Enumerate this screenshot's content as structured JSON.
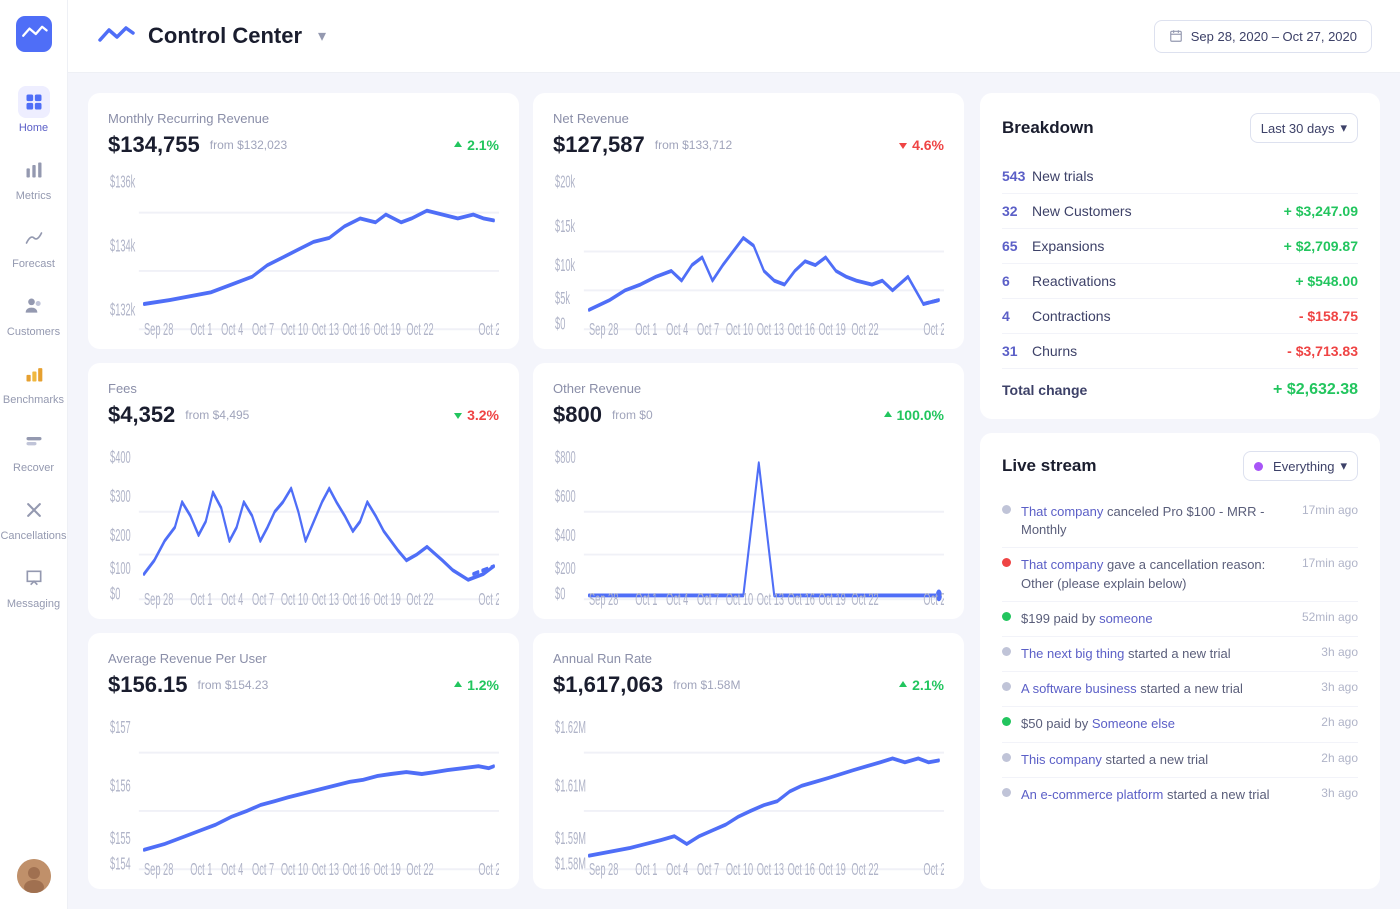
{
  "app": {
    "logo_alt": "App Logo",
    "title": "Control Center",
    "date_range": "Sep 28, 2020 – Oct 27, 2020"
  },
  "sidebar": {
    "items": [
      {
        "id": "home",
        "label": "Home",
        "active": true
      },
      {
        "id": "metrics",
        "label": "Metrics",
        "active": false
      },
      {
        "id": "forecast",
        "label": "Forecast",
        "active": false
      },
      {
        "id": "customers",
        "label": "Customers",
        "active": false
      },
      {
        "id": "benchmarks",
        "label": "Benchmarks",
        "active": false
      },
      {
        "id": "recover",
        "label": "Recover",
        "active": false
      },
      {
        "id": "cancellations",
        "label": "Cancellations",
        "active": false
      },
      {
        "id": "messaging",
        "label": "Messaging",
        "active": false
      }
    ]
  },
  "charts": [
    {
      "id": "mrr",
      "label": "Monthly Recurring Revenue",
      "value": "$134,755",
      "from": "from $132,023",
      "change": "2.1%",
      "direction": "up"
    },
    {
      "id": "net",
      "label": "Net Revenue",
      "value": "$127,587",
      "from": "from $133,712",
      "change": "4.6%",
      "direction": "down"
    },
    {
      "id": "fees",
      "label": "Fees",
      "value": "$4,352",
      "from": "from $4,495",
      "change": "3.2%",
      "direction": "down"
    },
    {
      "id": "other",
      "label": "Other Revenue",
      "value": "$800",
      "from": "from $0",
      "change": "100.0%",
      "direction": "up"
    },
    {
      "id": "arpu",
      "label": "Average Revenue Per User",
      "value": "$156.15",
      "from": "from $154.23",
      "change": "1.2%",
      "direction": "up"
    },
    {
      "id": "arr",
      "label": "Annual Run Rate",
      "value": "$1,617,063",
      "from": "from $1.58M",
      "change": "2.1%",
      "direction": "up"
    }
  ],
  "breakdown": {
    "title": "Breakdown",
    "period": "Last 30 days",
    "rows": [
      {
        "count": "543",
        "label": "New trials",
        "amount": null,
        "type": "neutral"
      },
      {
        "count": "32",
        "label": "New Customers",
        "amount": "+ $3,247.09",
        "type": "positive"
      },
      {
        "count": "65",
        "label": "Expansions",
        "amount": "+ $2,709.87",
        "type": "positive"
      },
      {
        "count": "6",
        "label": "Reactivations",
        "amount": "+ $548.00",
        "type": "positive"
      },
      {
        "count": "4",
        "label": "Contractions",
        "amount": "- $158.75",
        "type": "negative"
      },
      {
        "count": "31",
        "label": "Churns",
        "amount": "- $3,713.83",
        "type": "negative"
      }
    ],
    "total_label": "Total change",
    "total_amount": "+ $2,632.38"
  },
  "livestream": {
    "title": "Live stream",
    "filter": "Everything",
    "items": [
      {
        "dot": "gray",
        "text_parts": [
          {
            "type": "link",
            "text": "That company"
          },
          {
            "type": "plain",
            "text": " canceled Pro $100 - MRR - Monthly"
          }
        ],
        "time": "17min ago"
      },
      {
        "dot": "red",
        "text_parts": [
          {
            "type": "link",
            "text": "That company"
          },
          {
            "type": "plain",
            "text": " gave a cancellation reason: Other (please explain below)"
          }
        ],
        "time": "17min ago"
      },
      {
        "dot": "green",
        "text_parts": [
          {
            "type": "plain",
            "text": "$199 paid by "
          },
          {
            "type": "link",
            "text": "someone"
          }
        ],
        "time": "52min ago"
      },
      {
        "dot": "gray",
        "text_parts": [
          {
            "type": "link",
            "text": "The next big thing"
          },
          {
            "type": "plain",
            "text": " started a new trial"
          }
        ],
        "time": "3h ago"
      },
      {
        "dot": "gray",
        "text_parts": [
          {
            "type": "link",
            "text": "A software business"
          },
          {
            "type": "plain",
            "text": " started a new trial"
          }
        ],
        "time": "3h ago"
      },
      {
        "dot": "green",
        "text_parts": [
          {
            "type": "plain",
            "text": "$50 paid by "
          },
          {
            "type": "link",
            "text": "Someone else"
          }
        ],
        "time": "2h ago"
      },
      {
        "dot": "gray",
        "text_parts": [
          {
            "type": "link",
            "text": "This company"
          },
          {
            "type": "plain",
            "text": " started a new trial"
          }
        ],
        "time": "2h ago"
      },
      {
        "dot": "gray",
        "text_parts": [
          {
            "type": "link",
            "text": "An e-commerce platform"
          },
          {
            "type": "plain",
            "text": " started a new trial"
          }
        ],
        "time": "3h ago"
      }
    ]
  }
}
